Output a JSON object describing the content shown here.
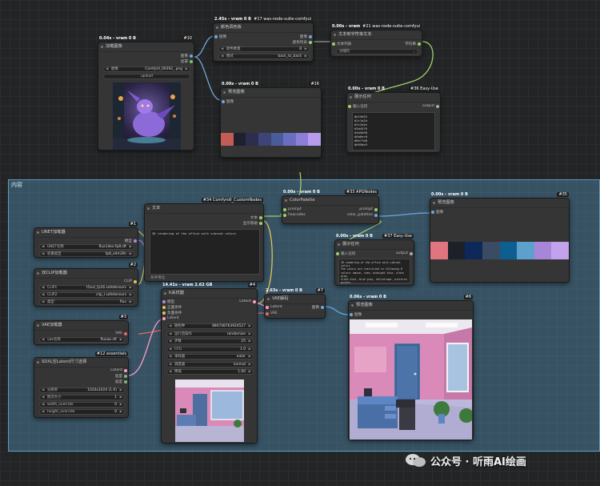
{
  "group": {
    "title": "内容"
  },
  "nodes": {
    "loadimg": {
      "badge": "0.04s - vram 0 B",
      "id": "#10",
      "title": "加载图像",
      "out1": "图像",
      "out2": "遮罩",
      "w_label": "图像",
      "w_value": "ComfyUI_00392_.png",
      "upload": "upload"
    },
    "colorpick": {
      "badge": "2.45s - vram 0 B",
      "id": "#17 was-node-suite-comfyui",
      "title": "颜色调色板",
      "in1": "图像",
      "out1": "图像",
      "out2": "颜色列表",
      "w1_label": "颜色数量",
      "w1_value": "8",
      "w2_label": "模式",
      "w2_value": "back_to_back"
    },
    "text2str": {
      "badge": "0.00s - vram 0 B",
      "id": "#21 was-node-suite-comfyui",
      "title": "文本到字符串文本",
      "in1": "文本列表",
      "out1": "字符串",
      "w_label": "分隔符",
      "w_value": ","
    },
    "preview16": {
      "badge": "0.00s - vram 0 B",
      "id": "#16",
      "title": "预览图像",
      "in1": "图像",
      "swatches": [
        "#c15d55",
        "#1f1f2e",
        "#2d2d50",
        "#3d4577",
        "#4a5b99",
        "#6a6ec0",
        "#8d7fd9",
        "#b79ceb"
      ]
    },
    "showtext36": {
      "badge": "0.00s - vram 0 B",
      "id": "#36 Easy-Use",
      "title": "展示任何",
      "in1": "输入任何",
      "out1": "output",
      "text": "#b15d55\n#1c1a2b\n#2c2d4e\n#3d4576\n#4b5b98\n#6a6ec0\n#8e7fd8\n#b99de9"
    },
    "textnode": {
      "id": "#34 Comfyroll_CustomNodes",
      "title": "文本",
      "out1": "文本",
      "out2": "显示帮助",
      "text": "3D rendering of the office with vibrant colors",
      "foot": "条件零化"
    },
    "palette": {
      "badge": "0.00s - vram 0 B",
      "id": "#33 APGNodes",
      "title": "ColorPalette",
      "in1": "prompt",
      "in2": "hexcodes",
      "out1": "prompt",
      "out2": "color_palettes"
    },
    "preview35": {
      "badge": "0.00s - vram 0 B",
      "id": "#35",
      "title": "预览图像",
      "in1": "图像",
      "swatches": [
        "#e07481",
        "#1c2029",
        "#0d2859",
        "#3a4b63",
        "#0d5f91",
        "#5ea0cc",
        "#a785d8",
        "#c2a2ec"
      ]
    },
    "showtext37": {
      "badge": "0.00s - vram 0 B",
      "id": "#37 Easy-Use",
      "title": "展示任何",
      "in1": "输入任何",
      "out1": "output",
      "text": "3D rendering of the office with vibrant colors\nThe colors are restricted to following 8\ncolors: mauve, rose, midnight blue, slate gray,\nslate blue, blue gray, heliotrope, wisteria\npurple."
    },
    "unet": {
      "id": "#1",
      "title": "UNET加载器",
      "out1": "模型",
      "w1_label": "UNET名称",
      "w1_value": "flux1dev-fp8.sft",
      "w2_label": "权重类型",
      "w2_value": "fp8_e4m3fn"
    },
    "clip": {
      "id": "#2",
      "title": "双CLIP加载器",
      "out1": "CLIP",
      "w1_label": "CLIP1",
      "w1_value": "t5xxl_fp16.safetensors",
      "w2_label": "CLIP2",
      "w2_value": "clip_l.safetensors",
      "w3_label": "类型",
      "w3_value": "flux"
    },
    "vae": {
      "id": "#3",
      "title": "VAE加载器",
      "out1": "VAE",
      "w_label": "vae名称",
      "w_value": "fluxae.sft"
    },
    "sdxl": {
      "id": "#12 essentials",
      "title": "SDXL空Latent尺寸选择",
      "out1": "Latent",
      "out2": "宽度",
      "out3": "高度",
      "w1_label": "分辨率",
      "w1_value": "1024x1024 (1.0)",
      "w2_label": "批次大小",
      "w2_value": "1",
      "w3_label": "width_override",
      "w3_value": "0",
      "w4_label": "height_override",
      "w4_value": "0"
    },
    "ksampler": {
      "badge": "14.41s - vram 2.62 GB",
      "id": "#4",
      "title": "K采样器",
      "in1": "模型",
      "in2": "正面条件",
      "in3": "负面条件",
      "in4": "Latent",
      "out1": "Latent",
      "widgets": [
        {
          "label": "随机种",
          "value": "884748763924527"
        },
        {
          "label": "运行后操作",
          "value": "randomize"
        },
        {
          "label": "步数",
          "value": "25"
        },
        {
          "label": "CFG",
          "value": "1.0"
        },
        {
          "label": "采样器",
          "value": "euler"
        },
        {
          "label": "调度器",
          "value": "normal"
        },
        {
          "label": "降噪",
          "value": "1.00"
        }
      ]
    },
    "vaedecode": {
      "badge": "2.63s - vram 0 B",
      "id": "#7",
      "title": "VAE解码",
      "in1": "Latent",
      "in2": "VAE",
      "out1": "图像"
    },
    "preview6": {
      "badge": "0.06s - vram 0 B",
      "id": "#6",
      "title": "预览图像",
      "in1": "图像"
    }
  },
  "watermark": "公众号 · 听雨AI绘画"
}
